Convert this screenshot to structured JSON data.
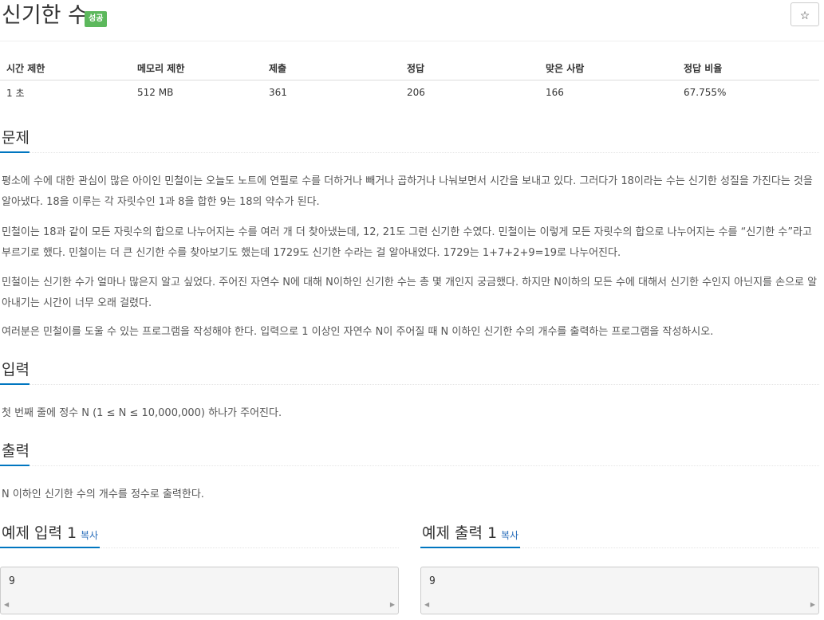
{
  "problem": {
    "title": "신기한 수",
    "status_badge": "성공",
    "star_icon": "☆"
  },
  "info_table": {
    "headers": [
      "시간 제한",
      "메모리 제한",
      "제출",
      "정답",
      "맞은 사람",
      "정답 비율"
    ],
    "values": [
      "1 초",
      "512 MB",
      "361",
      "206",
      "166",
      "67.755%"
    ]
  },
  "sections": {
    "description": {
      "title": "문제",
      "paragraphs": [
        "평소에 수에 대한 관심이 많은 아이인 민철이는 오늘도 노트에 연필로 수를 더하거나 빼거나 곱하거나 나눠보면서 시간을 보내고 있다. 그러다가 18이라는 수는 신기한 성질을 가진다는 것을 알아냈다. 18을 이루는 각 자릿수인 1과 8을 합한 9는 18의 약수가 된다.",
        "민철이는 18과 같이 모든 자릿수의 합으로 나누어지는 수를 여러 개 더 찾아냈는데, 12, 21도 그런 신기한 수였다. 민철이는 이렇게 모든 자릿수의 합으로 나누어지는 수를 “신기한 수”라고 부르기로 했다. 민철이는 더 큰 신기한 수를 찾아보기도 했는데 1729도 신기한 수라는 걸 알아내었다. 1729는 1+7+2+9=19로 나누어진다.",
        "민철이는 신기한 수가 얼마나 많은지 알고 싶었다. 주어진 자연수 N에 대해 N이하인 신기한 수는 총 몇 개인지 궁금했다. 하지만 N이하의 모든 수에 대해서 신기한 수인지 아닌지를 손으로 알아내기는 시간이 너무 오래 걸렸다.",
        "여러분은 민철이를 도울 수 있는 프로그램을 작성해야 한다. 입력으로 1 이상인 자연수 N이 주어질 때 N 이하인 신기한 수의 개수를 출력하는 프로그램을 작성하시오."
      ]
    },
    "input": {
      "title": "입력",
      "text": "첫 번째 줄에 정수 N (1 ≤ N ≤ 10,000,000) 하나가 주어진다."
    },
    "output": {
      "title": "출력",
      "text": "N 이하인 신기한 수의 개수를 정수로 출력한다."
    }
  },
  "samples": {
    "input": {
      "title": "예제 입력 1",
      "copy_label": "복사",
      "value": "9"
    },
    "output": {
      "title": "예제 출력 1",
      "copy_label": "복사",
      "value": "9"
    }
  },
  "colors": {
    "badge_success": "#5cb85c",
    "section_underline": "#0076c0",
    "copy_link": "#2a6ebb"
  }
}
